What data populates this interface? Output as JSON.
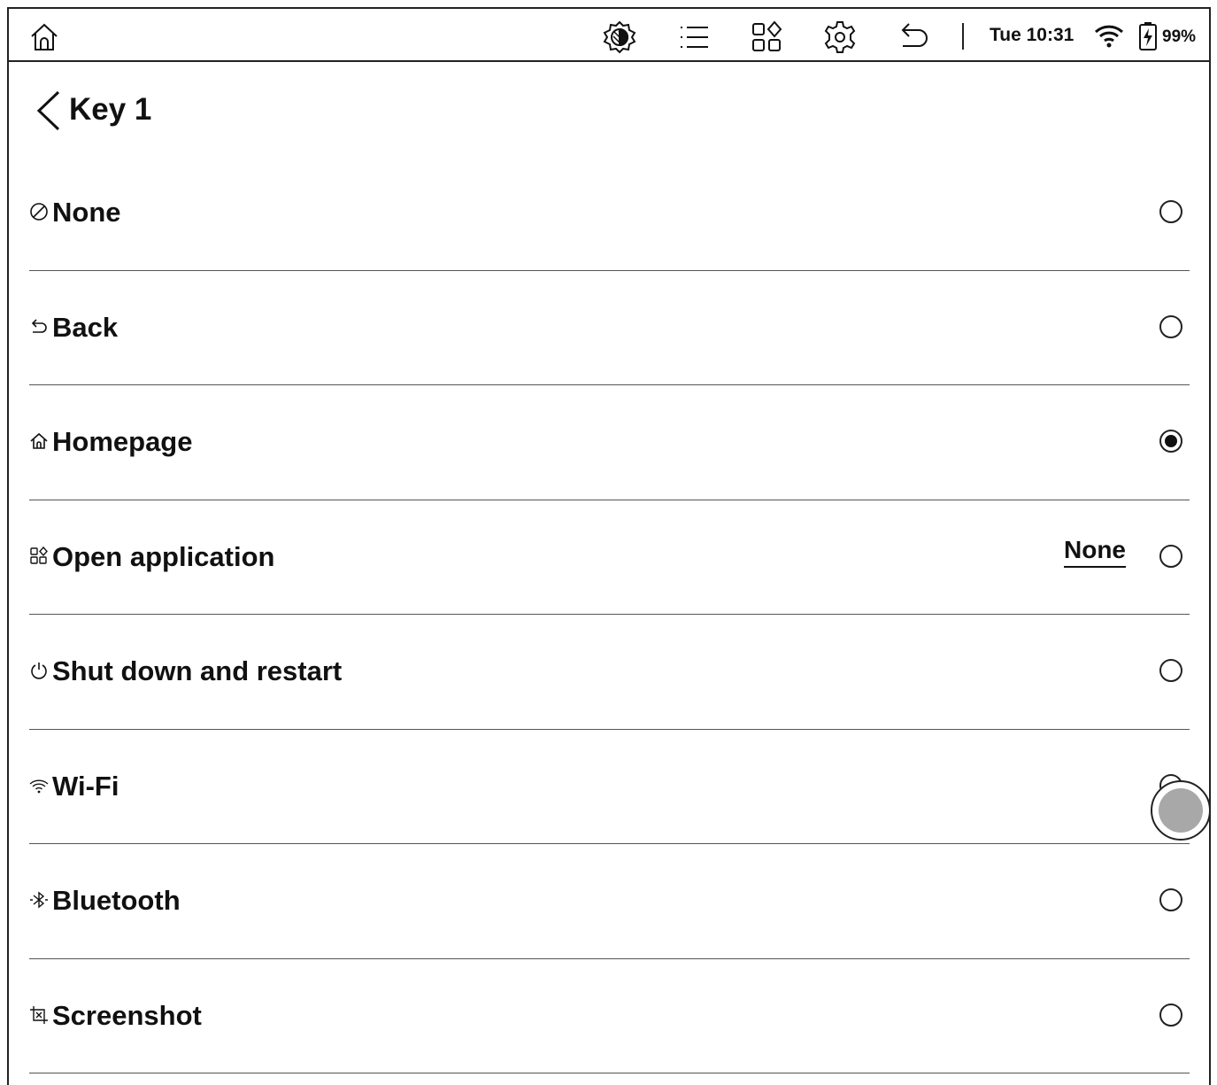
{
  "statusbar": {
    "time": "Tue 10:31",
    "battery": "99%",
    "icons": [
      "home-icon",
      "refresh-mode-icon",
      "list-icon",
      "apps-icon",
      "settings-icon",
      "back-icon",
      "wifi-icon",
      "battery-charging-icon"
    ]
  },
  "page": {
    "title": "Key 1"
  },
  "options": [
    {
      "label": "None",
      "icon": "none-icon",
      "selected": false
    },
    {
      "label": "Back",
      "icon": "back-icon",
      "selected": false
    },
    {
      "label": "Homepage",
      "icon": "home-icon",
      "selected": true
    },
    {
      "label": "Open application",
      "icon": "apps-icon",
      "value": "None",
      "selected": false
    },
    {
      "label": "Shut down and restart",
      "icon": "power-icon",
      "selected": false
    },
    {
      "label": "Wi-Fi",
      "icon": "wifi-icon",
      "selected": false
    },
    {
      "label": "Bluetooth",
      "icon": "bluetooth-icon",
      "selected": false
    },
    {
      "label": "Screenshot",
      "icon": "screenshot-icon",
      "selected": false
    }
  ],
  "colors": {
    "ink": "#111111",
    "divider": "#555555",
    "touch": "#a8a8a8"
  }
}
